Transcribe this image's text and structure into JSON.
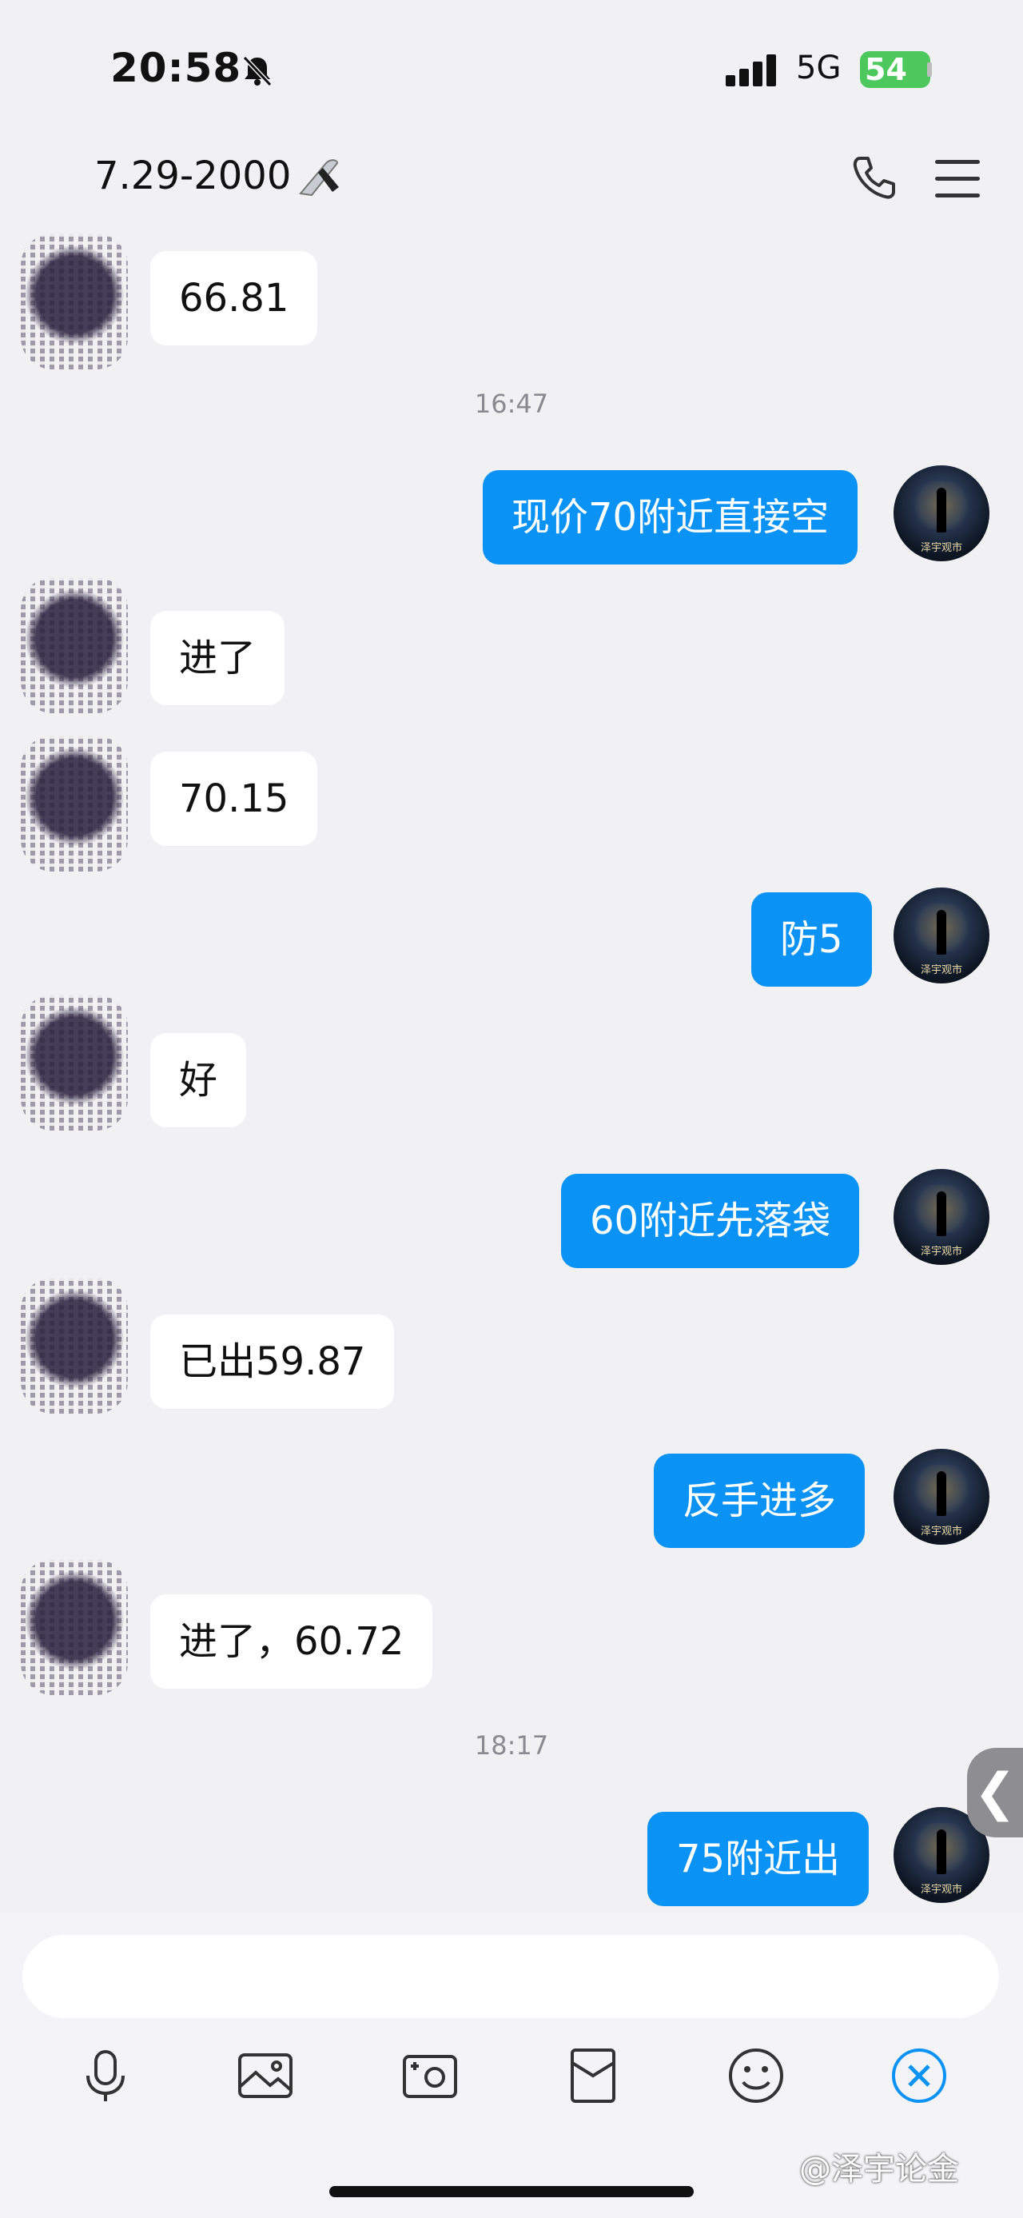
{
  "status_bar": {
    "time": "20:58",
    "network": "5G",
    "battery": "54"
  },
  "header": {
    "title": "7.29-2000"
  },
  "messages": {
    "m1": "66.81",
    "t1": "16:47",
    "m2": "现价70附近直接空",
    "m3": "进了",
    "m4": "70.15",
    "m5": "防5",
    "m6": "好",
    "m7": "60附近先落袋",
    "m8": "已出59.87",
    "m9": "反手进多",
    "m10": "进了，60.72",
    "t2": "18:17",
    "m11": "75附近出"
  },
  "avatar_caption": "泽宇观市",
  "side_tab": "❮",
  "watermark": "@泽宇论金",
  "colors": {
    "accent": "#0a93f5",
    "background": "#f1f1f3",
    "battery": "#4cc85c"
  },
  "icons": [
    "bell-muted-icon",
    "knife-icon",
    "phone-icon",
    "menu-icon",
    "mic-icon",
    "image-icon",
    "camera-icon",
    "red-packet-icon",
    "emoji-icon",
    "close-circle-icon"
  ]
}
